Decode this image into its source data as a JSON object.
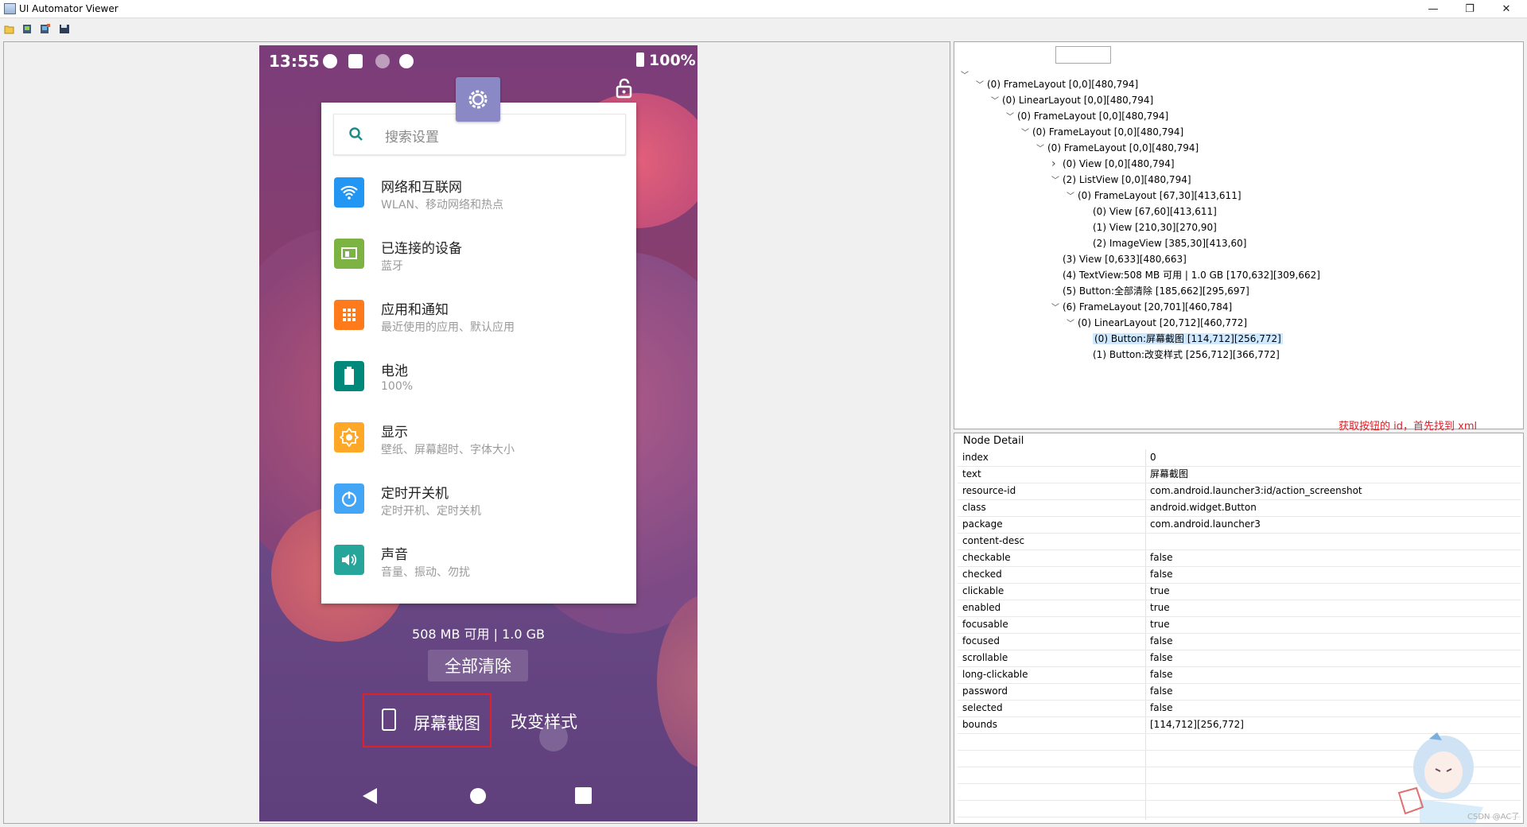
{
  "window": {
    "title": "UI Automator Viewer"
  },
  "window_controls": {
    "minimize": "—",
    "restore": "❐",
    "close": "✕"
  },
  "phone": {
    "status_time": "13:55",
    "battery": "100%",
    "search_placeholder": "搜索设置",
    "settings": [
      {
        "title": "网络和互联网",
        "subtitle": "WLAN、移动网络和热点",
        "icon": "wifi-icon",
        "color": "#2196f3"
      },
      {
        "title": "已连接的设备",
        "subtitle": "蓝牙",
        "icon": "devices-icon",
        "color": "#7cb342"
      },
      {
        "title": "应用和通知",
        "subtitle": "最近使用的应用、默认应用",
        "icon": "apps-icon",
        "color": "#ff7a1a"
      },
      {
        "title": "电池",
        "subtitle": "100%",
        "icon": "battery-icon",
        "color": "#00897b"
      },
      {
        "title": "显示",
        "subtitle": "壁纸、屏幕超时、字体大小",
        "icon": "brightness-icon",
        "color": "#ffa726"
      },
      {
        "title": "定时开关机",
        "subtitle": "定时开机、定时关机",
        "icon": "power-icon",
        "color": "#42a5f5"
      },
      {
        "title": "声音",
        "subtitle": "音量、振动、勿扰",
        "icon": "volume-icon",
        "color": "#26a69a"
      }
    ],
    "memory": "508 MB 可用 | 1.0 GB",
    "clear_all": "全部清除",
    "screenshot": "屏幕截图",
    "change_style": "改变样式"
  },
  "tree": [
    {
      "label": "(0) FrameLayout [0,0][480,794]",
      "depth": 1,
      "toggle": "open"
    },
    {
      "label": "(0) LinearLayout [0,0][480,794]",
      "depth": 2,
      "toggle": "open"
    },
    {
      "label": "(0) FrameLayout [0,0][480,794]",
      "depth": 3,
      "toggle": "open"
    },
    {
      "label": "(0) FrameLayout [0,0][480,794]",
      "depth": 4,
      "toggle": "open"
    },
    {
      "label": "(0) FrameLayout [0,0][480,794]",
      "depth": 5,
      "toggle": "open"
    },
    {
      "label": "(0) View [0,0][480,794]",
      "depth": 6,
      "toggle": "closed"
    },
    {
      "label": "(2) ListView [0,0][480,794]",
      "depth": 6,
      "toggle": "open"
    },
    {
      "label": "(0) FrameLayout [67,30][413,611]",
      "depth": 7,
      "toggle": "open"
    },
    {
      "label": "(0) View [67,60][413,611]",
      "depth": 8,
      "toggle": "none"
    },
    {
      "label": "(1) View [210,30][270,90]",
      "depth": 8,
      "toggle": "none"
    },
    {
      "label": "(2) ImageView [385,30][413,60]",
      "depth": 8,
      "toggle": "none"
    },
    {
      "label": "(3) View [0,633][480,663]",
      "depth": 6,
      "toggle": "none"
    },
    {
      "label": "(4) TextView:508 MB 可用 | 1.0 GB [170,632][309,662]",
      "depth": 6,
      "toggle": "none"
    },
    {
      "label": "(5) Button:全部清除 [185,662][295,697]",
      "depth": 6,
      "toggle": "none"
    },
    {
      "label": "(6) FrameLayout [20,701][460,784]",
      "depth": 6,
      "toggle": "open"
    },
    {
      "label": "(0) LinearLayout [20,712][460,772]",
      "depth": 7,
      "toggle": "open"
    },
    {
      "label": "(0) Button:屏幕截图 [114,712][256,772]",
      "depth": 8,
      "toggle": "none",
      "selected": true
    },
    {
      "label": "(1) Button:改变样式 [256,712][366,772]",
      "depth": 8,
      "toggle": "none"
    }
  ],
  "annotation": "获取按钮的 id，首先找到 xml",
  "node_detail": {
    "header": "Node Detail",
    "rows": [
      {
        "k": "index",
        "v": "0"
      },
      {
        "k": "text",
        "v": "屏幕截图"
      },
      {
        "k": "resource-id",
        "v": "com.android.launcher3:id/action_screenshot"
      },
      {
        "k": "class",
        "v": "android.widget.Button"
      },
      {
        "k": "package",
        "v": "com.android.launcher3"
      },
      {
        "k": "content-desc",
        "v": ""
      },
      {
        "k": "checkable",
        "v": "false"
      },
      {
        "k": "checked",
        "v": "false"
      },
      {
        "k": "clickable",
        "v": "true"
      },
      {
        "k": "enabled",
        "v": "true"
      },
      {
        "k": "focusable",
        "v": "true"
      },
      {
        "k": "focused",
        "v": "false"
      },
      {
        "k": "scrollable",
        "v": "false"
      },
      {
        "k": "long-clickable",
        "v": "false"
      },
      {
        "k": "password",
        "v": "false"
      },
      {
        "k": "selected",
        "v": "false"
      },
      {
        "k": "bounds",
        "v": "[114,712][256,772]"
      }
    ]
  },
  "watermark": "CSDN @AC了"
}
